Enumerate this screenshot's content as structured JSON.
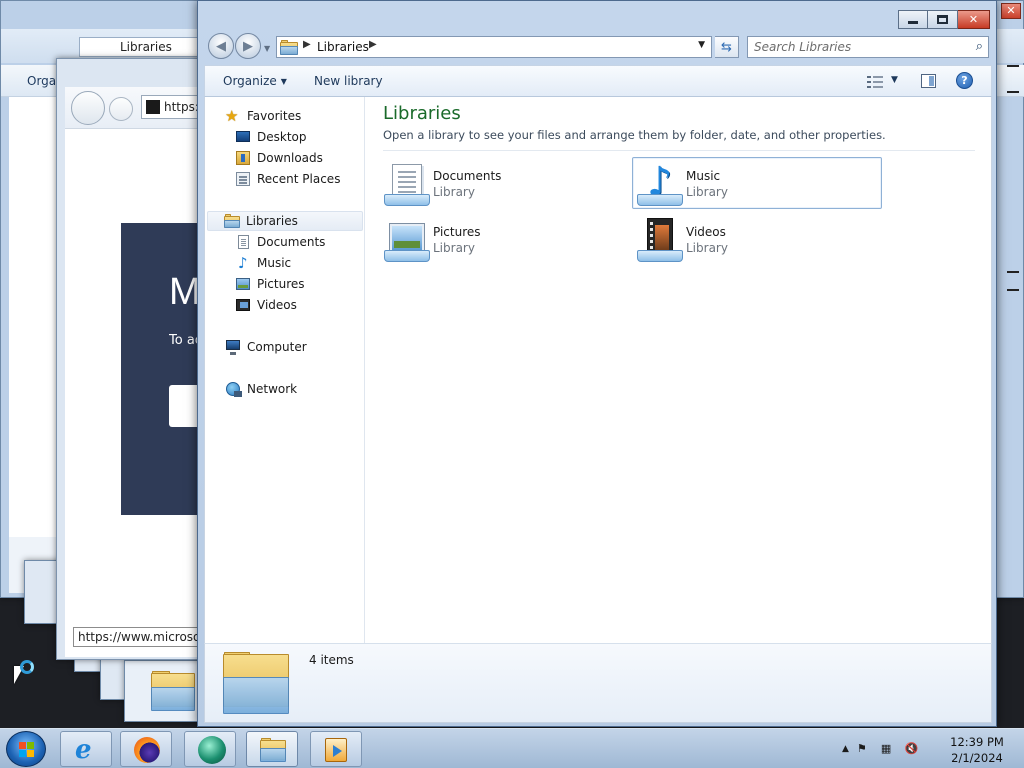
{
  "window": {
    "address": {
      "crumb": "Libraries"
    },
    "search": {
      "placeholder": "Search Libraries"
    },
    "toolbar": {
      "organize_label": "Organize",
      "new_library_label": "New library",
      "help_label": "?"
    }
  },
  "nav_pane": {
    "favorites_label": "Favorites",
    "favorites": [
      {
        "label": "Desktop",
        "icon": "desktop-icon"
      },
      {
        "label": "Downloads",
        "icon": "downloads-folder-icon"
      },
      {
        "label": "Recent Places",
        "icon": "recent-places-icon"
      }
    ],
    "libraries_label": "Libraries",
    "libraries": [
      {
        "label": "Documents",
        "icon": "documents-icon"
      },
      {
        "label": "Music",
        "icon": "music-icon"
      },
      {
        "label": "Pictures",
        "icon": "pictures-icon"
      },
      {
        "label": "Videos",
        "icon": "videos-icon"
      }
    ],
    "computer_label": "Computer",
    "network_label": "Network"
  },
  "content": {
    "title": "Libraries",
    "subtitle": "Open a library to see your files and arrange them by folder, date, and other properties.",
    "items": [
      {
        "name": "Documents",
        "type": "Library",
        "icon": "documents-library-icon",
        "selected": false
      },
      {
        "name": "Music",
        "type": "Library",
        "icon": "music-library-icon",
        "selected": true
      },
      {
        "name": "Pictures",
        "type": "Library",
        "icon": "pictures-library-icon",
        "selected": false
      },
      {
        "name": "Videos",
        "type": "Library",
        "icon": "videos-library-icon",
        "selected": false
      }
    ]
  },
  "details_pane": {
    "item_count": "4 items"
  },
  "background": {
    "explorer_crumb": "Libraries",
    "explorer_organize": "Orga",
    "browser_address": "https:/",
    "browser_heading": "M",
    "browser_text": "To ac",
    "browser_status": "https://www.microsof"
  },
  "taskbar": {
    "clock_time": "12:39 PM",
    "clock_date": "2/1/2024"
  }
}
